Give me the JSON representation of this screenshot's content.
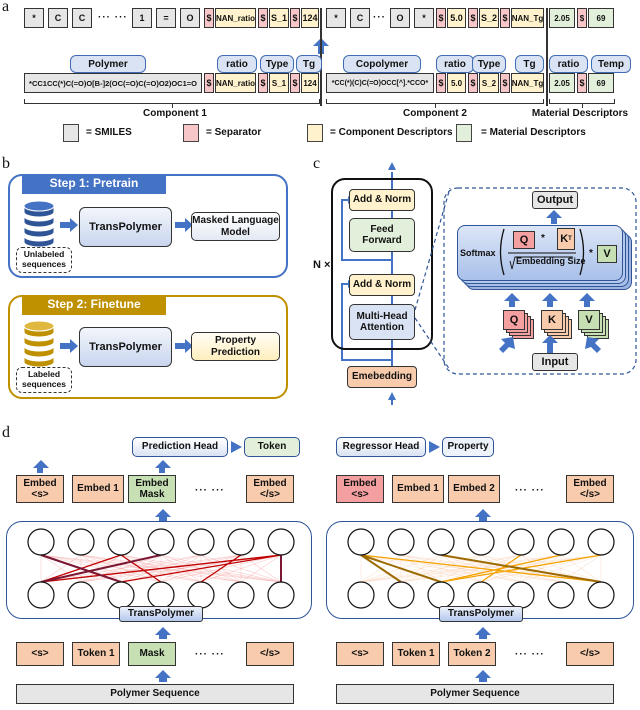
{
  "panels": {
    "a": "a",
    "b": "b",
    "c": "c",
    "d": "d"
  },
  "panel_a": {
    "top_tokens_c1": [
      {
        "text": "*",
        "kind": "smiles"
      },
      {
        "text": "C",
        "kind": "smiles"
      },
      {
        "text": "C",
        "kind": "smiles"
      },
      {
        "text": "1",
        "kind": "smiles"
      },
      {
        "text": "=",
        "kind": "smiles"
      },
      {
        "text": "O",
        "kind": "smiles"
      },
      {
        "text": "$",
        "kind": "separator"
      },
      {
        "text": "NAN_ratio",
        "kind": "component"
      },
      {
        "text": "$",
        "kind": "separator"
      },
      {
        "text": "S_1",
        "kind": "component"
      },
      {
        "text": "$",
        "kind": "separator"
      },
      {
        "text": "124",
        "kind": "component"
      }
    ],
    "top_tokens_c2": [
      {
        "text": "*",
        "kind": "smiles"
      },
      {
        "text": "C",
        "kind": "smiles"
      },
      {
        "text": "O",
        "kind": "smiles"
      },
      {
        "text": "*",
        "kind": "smiles"
      },
      {
        "text": "$",
        "kind": "separator"
      },
      {
        "text": "5.0",
        "kind": "component"
      },
      {
        "text": "$",
        "kind": "separator"
      },
      {
        "text": "S_2",
        "kind": "component"
      },
      {
        "text": "$",
        "kind": "separator"
      },
      {
        "text": "NAN_Tg",
        "kind": "component"
      }
    ],
    "top_tokens_md": [
      {
        "text": "2.05",
        "kind": "material"
      },
      {
        "text": "$",
        "kind": "separator"
      },
      {
        "text": "69",
        "kind": "material"
      }
    ],
    "ellipsis_long": "··· ···",
    "ellipsis_short": "···",
    "field_labels": {
      "polymer": "Polymer",
      "ratio1": "ratio",
      "type1": "Type",
      "tg1": "Tg",
      "copolymer": "Copolymer",
      "ratio2": "ratio",
      "type2": "Type",
      "tg2": "Tg",
      "ratio_md": "ratio",
      "temp": "Temp"
    },
    "bottom_c1": {
      "smiles": "*CC1CC(*)C(=O)O[B-]2(OC(=O)C(=O)O2)OC1=O",
      "sep1": "$",
      "ratio": "NAN_ratio",
      "sep2": "$",
      "type": "S_1",
      "sep3": "$",
      "tg": "124"
    },
    "bottom_c2": {
      "smiles": "*CC(*)(C)C(=O)OCC[^].*CCO*",
      "sep1": "$",
      "ratio": "5.0",
      "sep2": "$",
      "type": "S_2",
      "sep3": "$",
      "tg": "NAN_Tg"
    },
    "bottom_md": {
      "ratio": "2.05",
      "sep": "$",
      "temp": "69"
    },
    "captions": {
      "c1": "Component 1",
      "c2": "Component 2",
      "md": "Material Descriptors"
    },
    "legend": [
      {
        "label": "= SMILES",
        "color": "#e6e6e6"
      },
      {
        "label": "= Separator",
        "color": "#f7c6c9"
      },
      {
        "label": "= Component Descriptors",
        "color": "#fff2cc"
      },
      {
        "label": "= Material Descriptors",
        "color": "#e2efda"
      }
    ]
  },
  "panel_b": {
    "step1": {
      "title": "Step 1: Pretrain",
      "color": "#4472c4",
      "data_label": "Unlabeled sequences",
      "model": "TransPolymer",
      "output": "Masked Language Model"
    },
    "step2": {
      "title": "Step 2: Finetune",
      "color": "#bf9000",
      "data_label": "Labeled sequences",
      "model": "TransPolymer",
      "output": "Property Prediction"
    }
  },
  "panel_c": {
    "repeat": "N ×",
    "add_norm_top": "Add & Norm",
    "feed_forward": "Feed Forward",
    "add_norm_bottom": "Add & Norm",
    "mha": "Multi-Head Attention",
    "embedding": "Emebedding",
    "output": "Output",
    "softmax": "Softmax",
    "q": "Q",
    "kt": "K",
    "kt_sup": "T",
    "v": "V",
    "denominator": "Embedding Size",
    "k": "K",
    "input": "Input",
    "dot": "*"
  },
  "panel_d": {
    "left": {
      "head": "Prediction Head",
      "head_out": "Token",
      "embeds": [
        "Embed <s>",
        "Embed 1",
        "Embed Mask",
        "Embed </s>"
      ],
      "model": "TransPolymer",
      "tokens": [
        "<s>",
        "Token 1",
        "Mask",
        "</s>"
      ],
      "sequence": "Polymer Sequence",
      "ellipsis": "··· ···"
    },
    "right": {
      "head": "Regressor Head",
      "head_out": "Property",
      "embeds": [
        "Embed <s>",
        "Embed 1",
        "Embed 2",
        "Embed </s>"
      ],
      "model": "TransPolymer",
      "tokens": [
        "<s>",
        "Token 1",
        "Token 2",
        "</s>"
      ],
      "sequence": "Polymer Sequence",
      "ellipsis": "··· ···"
    }
  },
  "colors": {
    "accent_blue": "#4472c4",
    "gold": "#bf9000",
    "embed_orange": "#f8cbad",
    "mask_green": "#c6e0b4",
    "embed_red": "#f4a0a0",
    "attention_red": "#c00000",
    "attention_orange": "#f4a300"
  }
}
